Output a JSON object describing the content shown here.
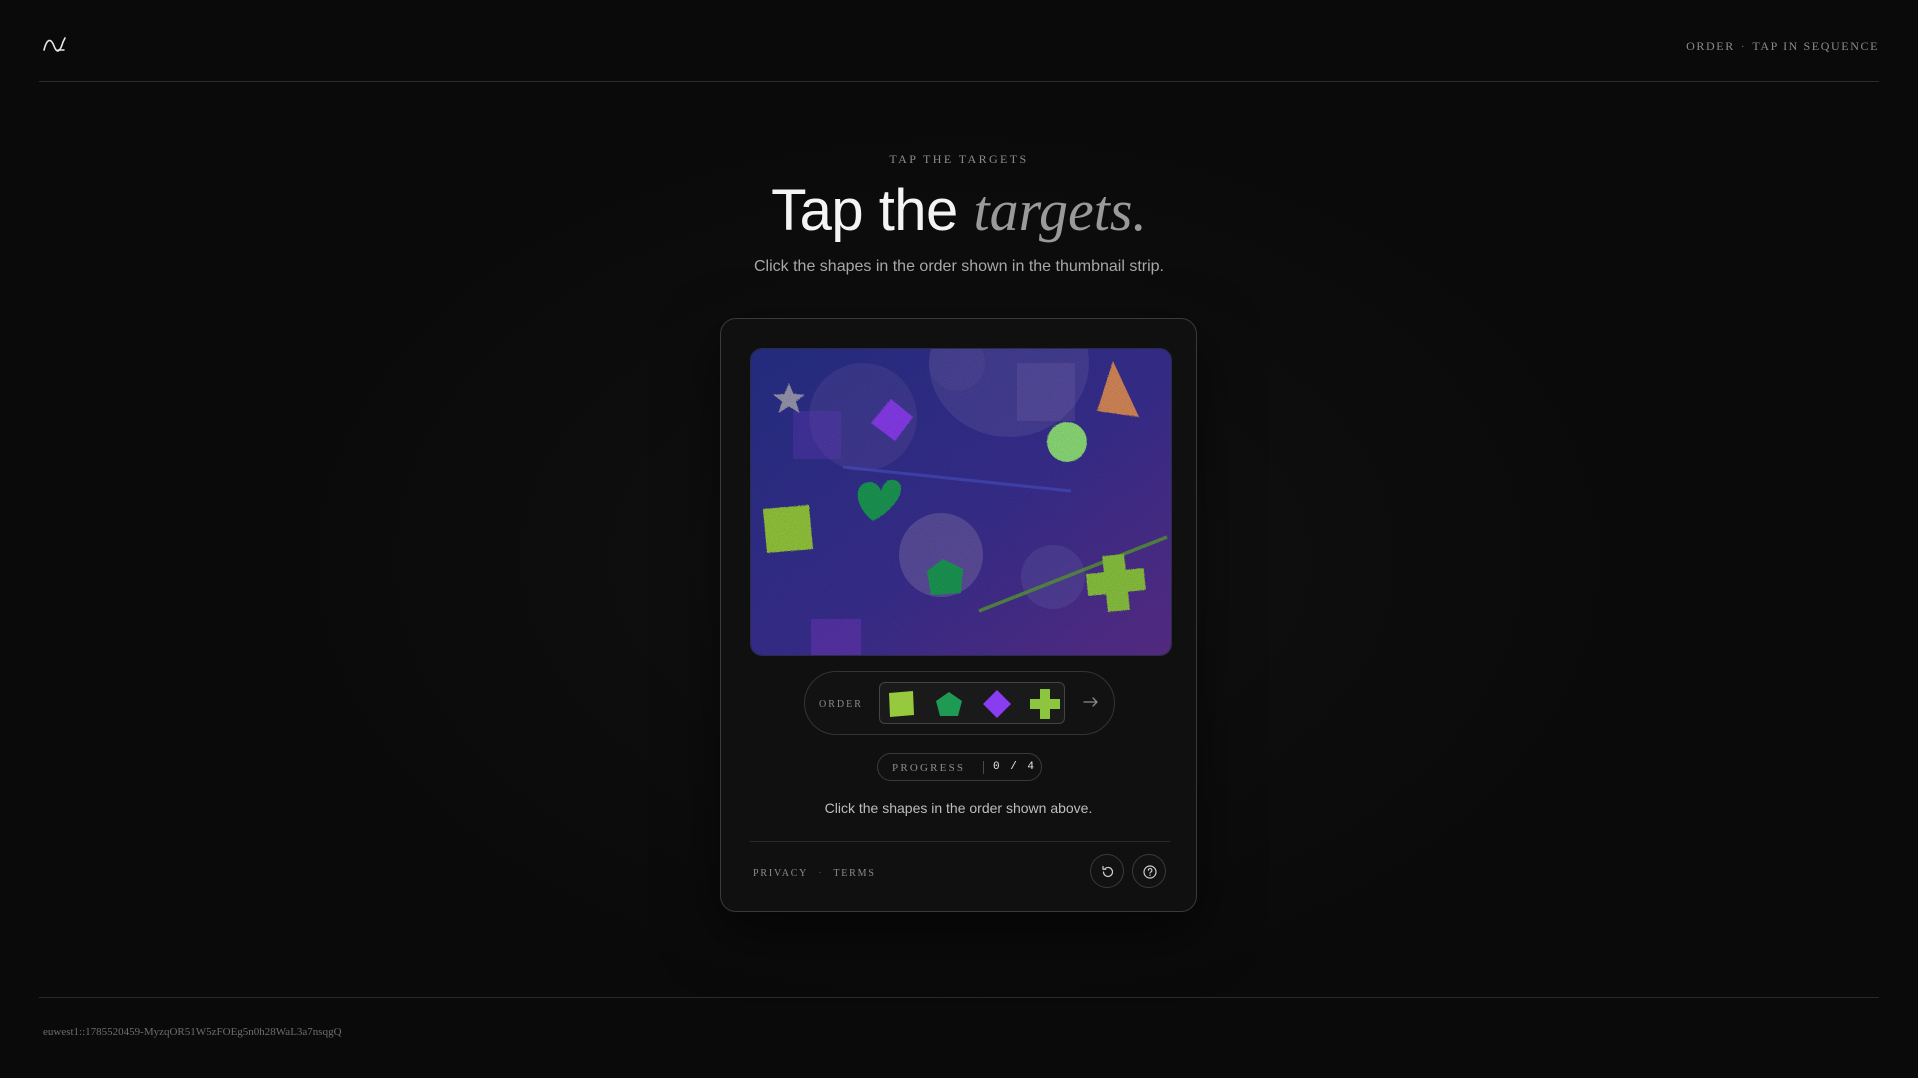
{
  "header": {
    "logo_icon": "wave-logo-icon",
    "meta_left": "ORDER",
    "meta_separator": "·",
    "meta_right": "TAP IN SEQUENCE"
  },
  "hero": {
    "eyebrow": "TAP THE TARGETS",
    "title_plain": "Tap the",
    "title_emphasis": "targets.",
    "subtitle": "Click the shapes in the order shown in the thumbnail strip."
  },
  "challenge": {
    "canvas_shapes": [
      "gray star",
      "purple diamond",
      "orange triangle",
      "light green circle",
      "green square",
      "green heart",
      "green pentagon",
      "green cross"
    ],
    "order": {
      "label": "ORDER",
      "sequence": [
        "square",
        "pentagon",
        "diamond",
        "cross"
      ],
      "arrow_icon": "arrow-right-icon"
    },
    "progress": {
      "label": "PROGRESS",
      "value": "0 / 4",
      "current": 0,
      "total": 4
    },
    "instruction": "Click the shapes in the order shown above."
  },
  "card_footer": {
    "privacy": "PRIVACY",
    "separator": "·",
    "terms": "TERMS",
    "refresh_icon": "refresh-icon",
    "help_icon": "help-circle-icon"
  },
  "footer": {
    "session_id": "euwest1::1785520459-MyzqOR51W5zFOEg5n0h28WaL3a7nsqgQ"
  },
  "colors": {
    "background": "#0b0b0b",
    "canvas_blue": "#2d2f8a",
    "canvas_purple": "#5a2f8a",
    "shape_green": "#8cc63f",
    "shape_dark_green": "#1f9a55",
    "shape_purple": "#8a3cf0",
    "shape_orange": "#d98a5a"
  }
}
